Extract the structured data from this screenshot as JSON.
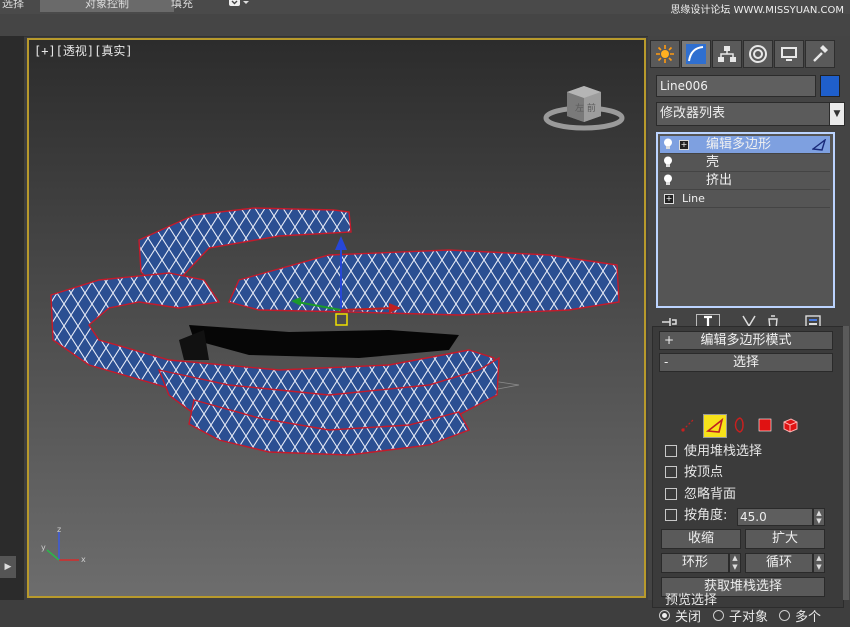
{
  "topbar": {
    "tab_left": "选择",
    "tab_active": "对象控制",
    "tab_fill": "填充",
    "watermark": "思缘设计论坛 WWW.MISSYUAN.COM"
  },
  "viewport": {
    "label": "[+][透视][真实]",
    "viewcube_face": "左 前",
    "border_color": "#b89a2c"
  },
  "command_panel": {
    "tabs": [
      "sun-icon",
      "curve-icon",
      "hierarchy-icon",
      "motion-icon",
      "display-icon",
      "hammer-icon"
    ],
    "object_name": "Line006",
    "object_color": "#1f5fcb",
    "modifier_list": "修改器列表",
    "stack": [
      {
        "label": "编辑多边形",
        "selected": true
      },
      {
        "label": "壳",
        "selected": false
      },
      {
        "label": "挤出",
        "selected": false
      },
      {
        "label": "Line",
        "selected": false
      }
    ],
    "rollout_mode": "编辑多边形模式",
    "rollout_select": "选择",
    "checkboxes": [
      "使用堆栈选择",
      "按顶点",
      "忽略背面",
      "按角度:"
    ],
    "angle_value": "45.0",
    "buttons": {
      "shrink": "收缩",
      "grow": "扩大",
      "ring": "环形",
      "loop": "循环",
      "get_stack_selection": "获取堆栈选择"
    },
    "preview": {
      "label": "预览选择",
      "options": [
        "关闭",
        "子对象",
        "多个"
      ]
    }
  }
}
